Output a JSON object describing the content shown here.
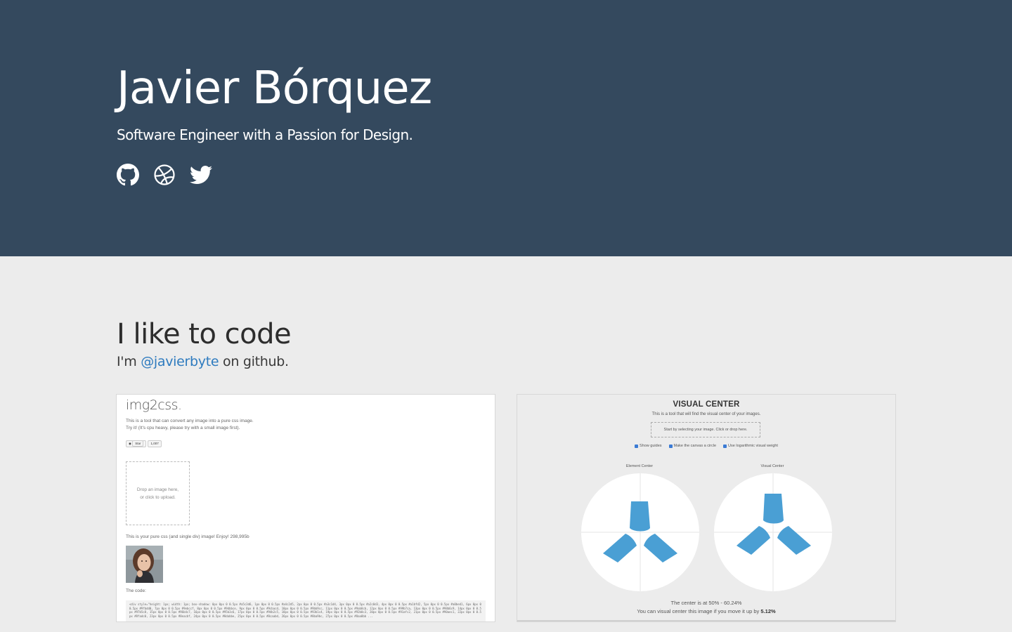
{
  "hero": {
    "name": "Javier Bórquez",
    "tagline": "Software Engineer with a Passion for Design.",
    "social": [
      "github-icon",
      "dribbble-icon",
      "twitter-icon"
    ]
  },
  "colors": {
    "hero_bg": "#34495e",
    "page_bg": "#ececec",
    "link": "#2e7bbf",
    "shape_blue": "#4a9fd4"
  },
  "code_section": {
    "title": "I like to code",
    "subtitle_prefix": "I'm ",
    "handle": "@javierbyte",
    "subtitle_suffix": " on github."
  },
  "projects": [
    {
      "title": "img2css.",
      "desc_line1": "This is a tool that can convert any image into a pure css image.",
      "desc_line2": "Try it! (It's cpu heavy, please try with a small image first).",
      "star_label": "Star",
      "star_count": "1,007",
      "drop_line1": "Drop an image here,",
      "drop_line2": "or click to upload.",
      "result_text": "This is your pure css (and single div) image! Enjoy! 298,995b",
      "code_label": "The code:",
      "code_snippet": "<div style=\"height: 1px; width: 1px; box-shadow: 0px 0px 0 0.5px #a5c3d6, 1px 0px 0 0.5px #a4c2d5, 2px 0px 0 0.5px #a3c1d4, 3px 0px 0 0.5px #a2c0d3, 4px 0px 0 0.5px #a1bfd2, 5px 0px 0 0.5px #a0bed1, 6px 0px 0 0.5px #9fbdd0, 7px 0px 0 0.5px #9ebccf, 8px 0px 0 0.5px #9dbbce, 9px 0px 0 0.5px #9cbacd, 10px 0px 0 0.5px #9bb9cc, 11px 0px 0 0.5px #9ab8cb, 12px 0px 0 0.5px #99b7ca, 13px 0px 0 0.5px #98b6c9, 14px 0px 0 0.5px #97b5c8, 15px 0px 0 0.5px #96b4c7, 16px 0px 0 0.5px #95b3c6, 17px 0px 0 0.5px #94b2c5, 18px 0px 0 0.5px #93b1c4, 19px 0px 0 0.5px #92b0c3, 20px 0px 0 0.5px #91afc2, 21px 0px 0 0.5px #90aec1, 22px 0px 0 0.5px #8fadc0, 23px 0px 0 0.5px #8eacbf, 24px 0px 0 0.5px #8dabbe, 25px 0px 0 0.5px #8caabd, 26px 0px 0 0.5px #8ba9bc, 27px 0px 0 0.5px #8aa8bb ..."
    },
    {
      "title": "VISUAL CENTER",
      "desc": "This is a tool that will find the visual center of your images.",
      "drop_text": "Start by selecting your image. Click or drop here.",
      "checks": [
        "Show guides",
        "Make the canvas a circle",
        "Use logarithmic visual weight"
      ],
      "label_left": "Element Center",
      "label_right": "Visual Center",
      "center_text": "The center is at 50% - 60.24%",
      "move_prefix": "You can visual center this image if you move it up by ",
      "move_value": "5.12%"
    }
  ]
}
